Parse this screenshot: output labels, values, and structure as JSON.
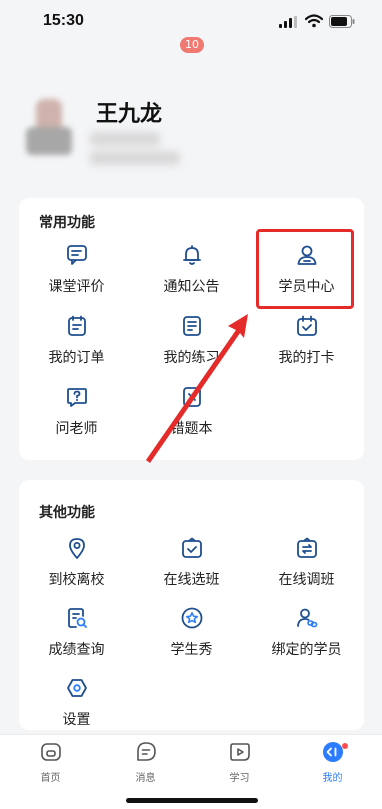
{
  "status_bar": {
    "time": "15:30"
  },
  "profile": {
    "name": "王九龙"
  },
  "common_functions": {
    "title": "常用功能",
    "items": [
      {
        "label": "课堂评价",
        "icon": "chat-icon"
      },
      {
        "label": "通知公告",
        "icon": "bell-icon",
        "badge": "10"
      },
      {
        "label": "学员中心",
        "icon": "person-icon"
      },
      {
        "label": "我的订单",
        "icon": "order-icon"
      },
      {
        "label": "我的练习",
        "icon": "exercise-icon"
      },
      {
        "label": "我的打卡",
        "icon": "checkin-calendar-icon"
      },
      {
        "label": "问老师",
        "icon": "question-icon"
      },
      {
        "label": "错题本",
        "icon": "error-book-icon"
      }
    ]
  },
  "other_functions": {
    "title": "其他功能",
    "items": [
      {
        "label": "到校离校",
        "icon": "location-icon"
      },
      {
        "label": "在线选班",
        "icon": "select-class-icon"
      },
      {
        "label": "在线调班",
        "icon": "switch-class-icon"
      },
      {
        "label": "成绩查询",
        "icon": "score-search-icon"
      },
      {
        "label": "学生秀",
        "icon": "star-icon"
      },
      {
        "label": "绑定的学员",
        "icon": "link-person-icon"
      },
      {
        "label": "设置",
        "icon": "settings-icon"
      }
    ]
  },
  "tab_bar": {
    "tabs": [
      {
        "label": "首页",
        "icon": "home-icon"
      },
      {
        "label": "消息",
        "icon": "message-icon"
      },
      {
        "label": "学习",
        "icon": "play-icon"
      },
      {
        "label": "我的",
        "icon": "profile-icon",
        "active": true
      }
    ]
  },
  "colors": {
    "accent": "#2b7cff",
    "icon_stroke": "#1f4f8f",
    "annotation_red": "#e52a2a",
    "badge": "#f07a71"
  }
}
